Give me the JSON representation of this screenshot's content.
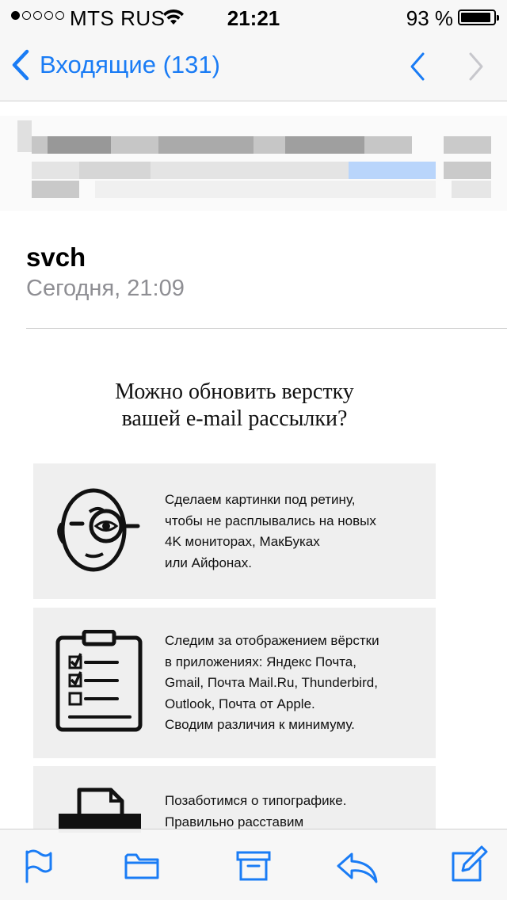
{
  "status_bar": {
    "carrier": "MTS RUS",
    "time": "21:21",
    "battery_percent": "93 %",
    "battery_level": 0.93,
    "signal_bars": 1
  },
  "nav": {
    "back_label": "Входящие (131)",
    "accent_color": "#1a7cf5"
  },
  "message": {
    "sender": "svch",
    "date": "Сегодня, 21:09"
  },
  "email": {
    "headline": "Можно обновить верстку\nвашей e-mail рассылки?",
    "cards": [
      {
        "icon": "retina-eye-icon",
        "text": "Сделаем картинки под ретину,\nчтобы не расплывались на новых\n4K мониторах, МакБуках\nили Айфонах."
      },
      {
        "icon": "clipboard-checklist-icon",
        "text": "Следим за отображением вёрстки\nв приложениях: Яндекс Почта,\nGmail, Почта Mail.Ru, Thunderbird,\nOutlook, Почта от Apple.\nСводим различия к минимуму."
      },
      {
        "icon": "printer-icon",
        "text": "Позаботимся о типографике.\nПравильно расставим"
      }
    ]
  },
  "toolbar": {
    "items": [
      "flag-icon",
      "folder-icon",
      "archive-icon",
      "reply-icon",
      "compose-icon"
    ]
  }
}
